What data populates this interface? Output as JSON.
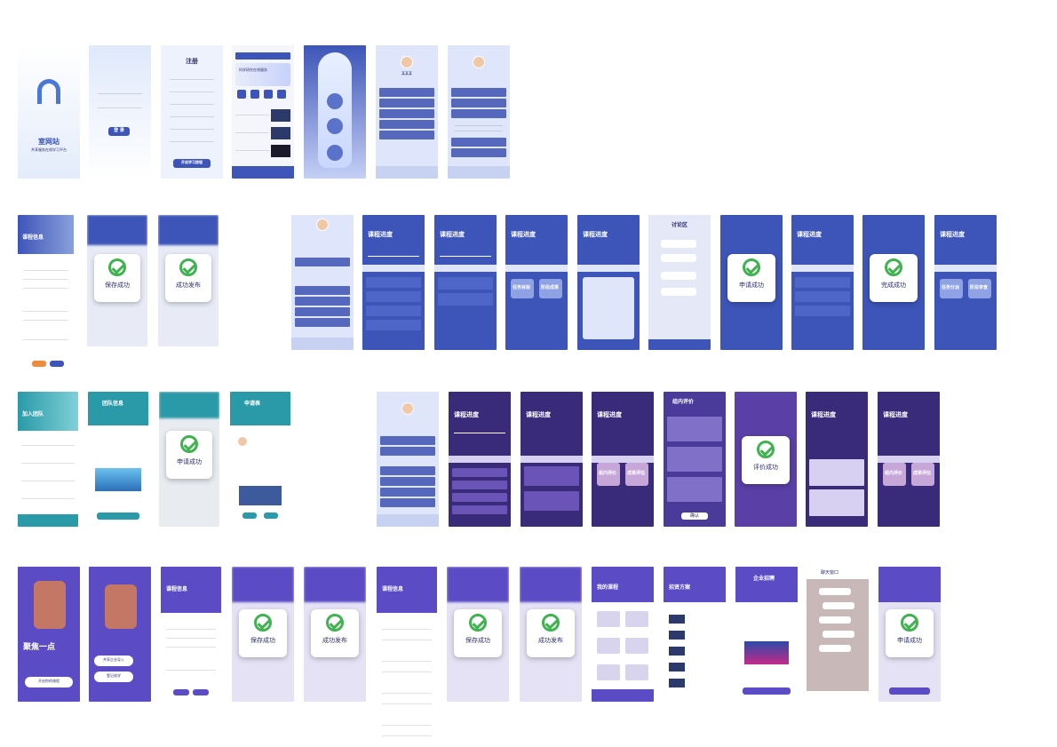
{
  "colors": {
    "blue_primary": "#3d55b8",
    "blue_light": "#dfe6fb",
    "teal": "#2a9aa8",
    "purple": "#5a3fa6",
    "purple_dark": "#3a2a7a",
    "violet": "#5b4bc4",
    "success": "#3fb34f"
  },
  "row1": {
    "splash_title": "室网站",
    "splash_subtitle": "共享服务在线学习平台",
    "login_button": "登 录",
    "register_title": "注册",
    "register_button": "开启学习旅程",
    "home_banner": "科学研究在线服务",
    "profile_name": "某某某"
  },
  "row2": {
    "info_title": "课程信息",
    "save_success": "保存成功",
    "publish_success": "成功发布",
    "progress_title": "课程进度",
    "chat_title": "讨论区",
    "apply_success": "申请成功",
    "complete_success": "完成成功",
    "card_left": "任务目标",
    "card_right": "阶段成果",
    "card_left_b": "任务分派",
    "card_right_b": "阶段审查"
  },
  "row3": {
    "join_title": "加入团队",
    "team_title": "团队信息",
    "apply_success": "申请成功",
    "apply_form_title": "申请表",
    "progress_title": "课程进度",
    "review_title": "组内评价",
    "evaluate_success": "评价成功",
    "card_left": "组内评价",
    "card_right": "成果评估",
    "confirm_button": "确认"
  },
  "row4": {
    "hero_title": "聚焦一点",
    "hero_sub": "",
    "start_button": "开启你的旅程",
    "enterprise_button": "共享企业导入",
    "register_button": "登记成学",
    "course_title": "课程信息",
    "save_success": "保存成功",
    "publish_success": "成功发布",
    "my_course": "我的课程",
    "recruit": "招贤方案",
    "enterprise": "企业招聘",
    "chat": "聊天窗口",
    "apply_success": "申请成功"
  }
}
